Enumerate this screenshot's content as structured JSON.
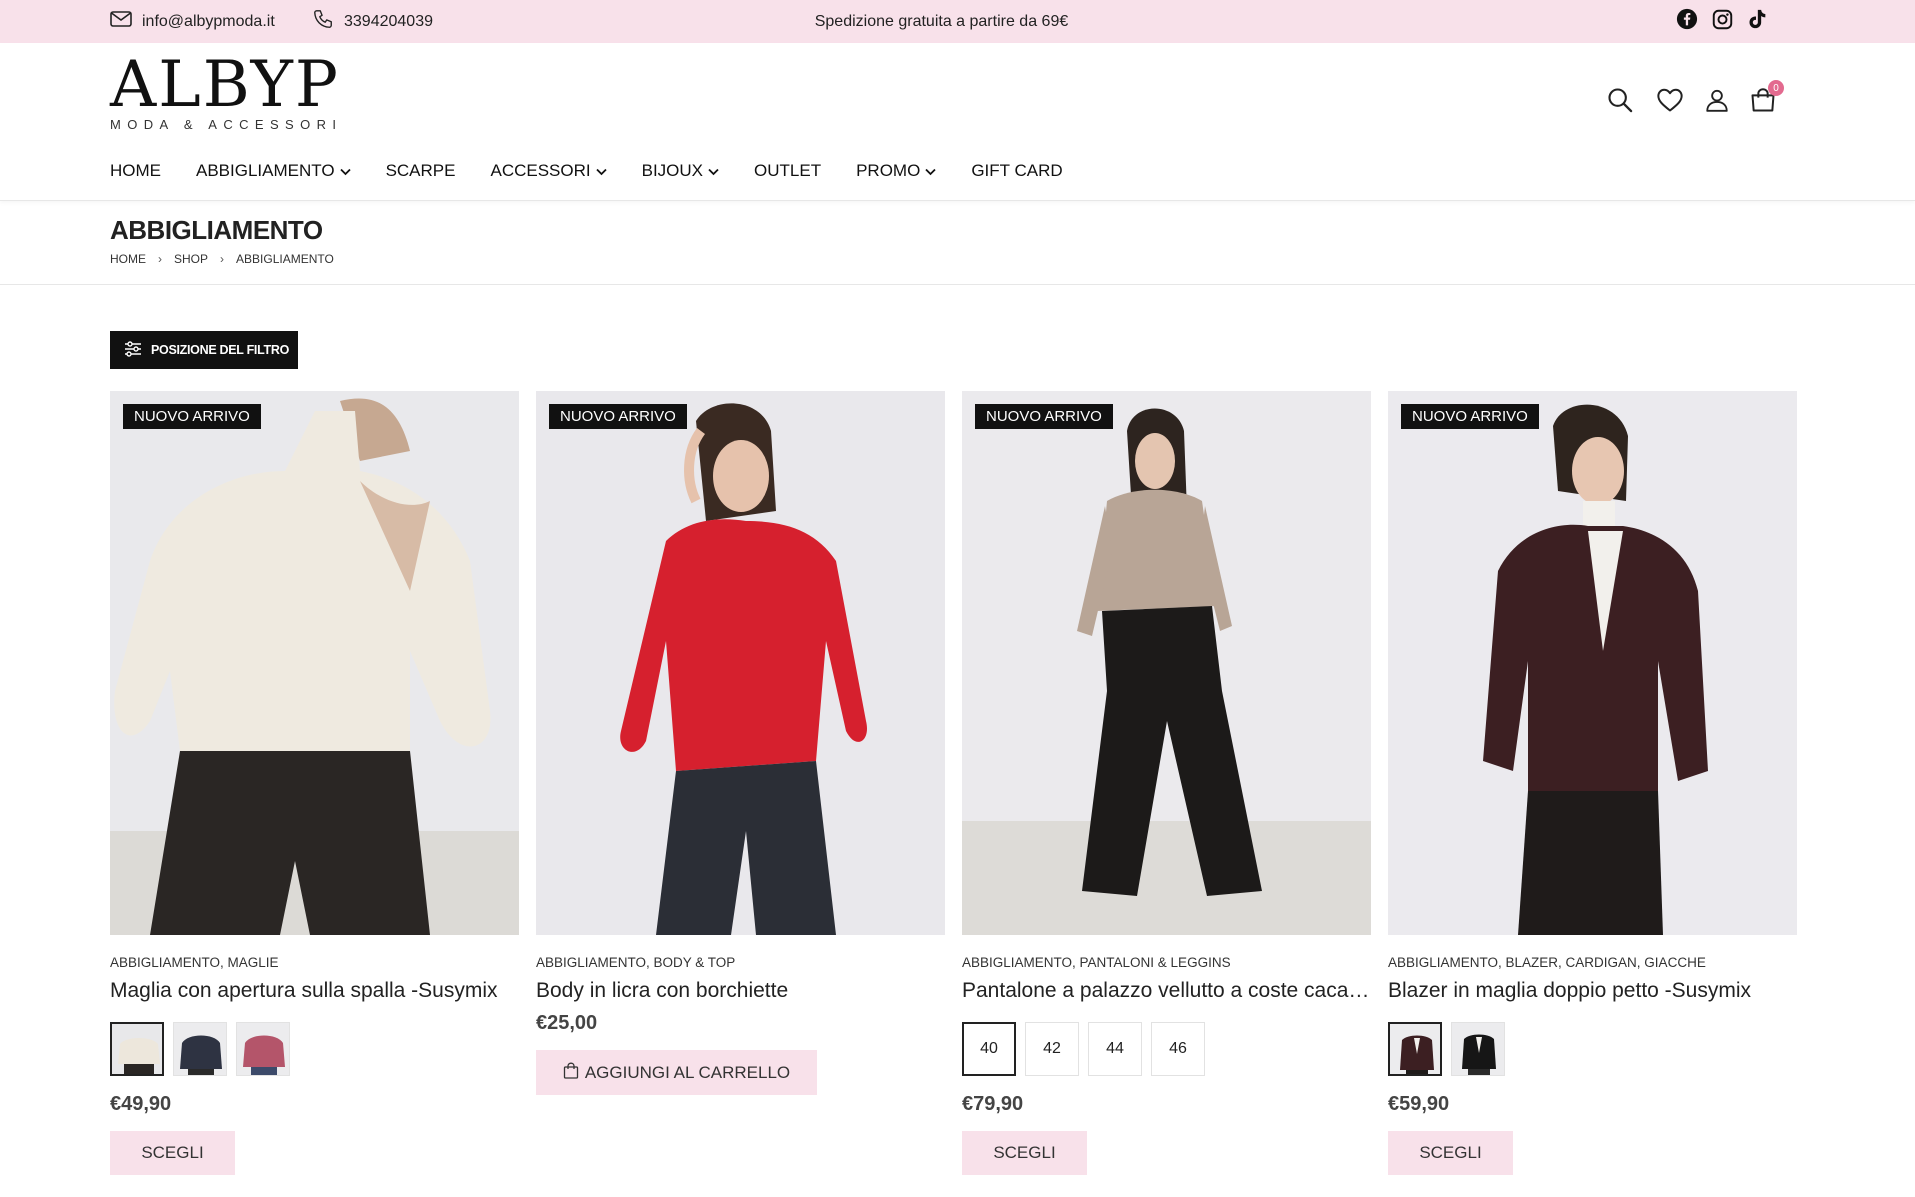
{
  "topbar": {
    "email": "info@albypmoda.it",
    "phone": "3394204039",
    "shipping_notice": "Spedizione gratuita a partire da 69€",
    "social_icons": [
      "facebook-icon",
      "instagram-icon",
      "tiktok-icon"
    ]
  },
  "header": {
    "logo_text": "ALBYP",
    "logo_subtext": "MODA & ACCESSORI",
    "icons": [
      "search-icon",
      "heart-icon",
      "user-icon",
      "cart-icon"
    ],
    "cart_count": "0"
  },
  "nav": {
    "items": [
      {
        "label": "HOME",
        "dropdown": false
      },
      {
        "label": "ABBIGLIAMENTO",
        "dropdown": true
      },
      {
        "label": "SCARPE",
        "dropdown": false
      },
      {
        "label": "ACCESSORI",
        "dropdown": true
      },
      {
        "label": "BIJOUX",
        "dropdown": true
      },
      {
        "label": "OUTLET",
        "dropdown": false
      },
      {
        "label": "PROMO",
        "dropdown": true
      },
      {
        "label": "GIFT CARD",
        "dropdown": false
      }
    ]
  },
  "page": {
    "title": "ABBIGLIAMENTO",
    "breadcrumb": [
      "HOME",
      "SHOP",
      "ABBIGLIAMENTO"
    ]
  },
  "filter_button": "POSIZIONE DEL FILTRO",
  "products": [
    {
      "badge": "NUOVO ARRIVO",
      "category": "ABBIGLIAMENTO, MAGLIE",
      "name": "Maglia con apertura sulla spalla -Susymix",
      "price": "€49,90",
      "action": "SCEGLI",
      "swatch_count": 3
    },
    {
      "badge": "NUOVO ARRIVO",
      "category": "ABBIGLIAMENTO, BODY & TOP",
      "name": "Body in licra con borchiette",
      "price": "€25,00",
      "action": "AGGIUNGI AL CARRELLO"
    },
    {
      "badge": "NUOVO ARRIVO",
      "category": "ABBIGLIAMENTO, PANTALONI & LEGGINS",
      "name": "Pantalone a palazzo vellutto a coste cacao -Susymix",
      "price": "€79,90",
      "action": "SCEGLI",
      "sizes": [
        "40",
        "42",
        "44",
        "46"
      ]
    },
    {
      "badge": "NUOVO ARRIVO",
      "category": "ABBIGLIAMENTO, BLAZER, CARDIGAN, GIACCHE",
      "name": "Blazer in maglia doppio petto -Susymix",
      "price": "€59,90",
      "action": "SCEGLI",
      "swatch_count": 2
    }
  ],
  "colors": {
    "topbar_bg": "#f8e1ea",
    "button_pink": "#f8e1ea",
    "badge_black": "#111111",
    "cart_badge": "#e36a8f"
  }
}
